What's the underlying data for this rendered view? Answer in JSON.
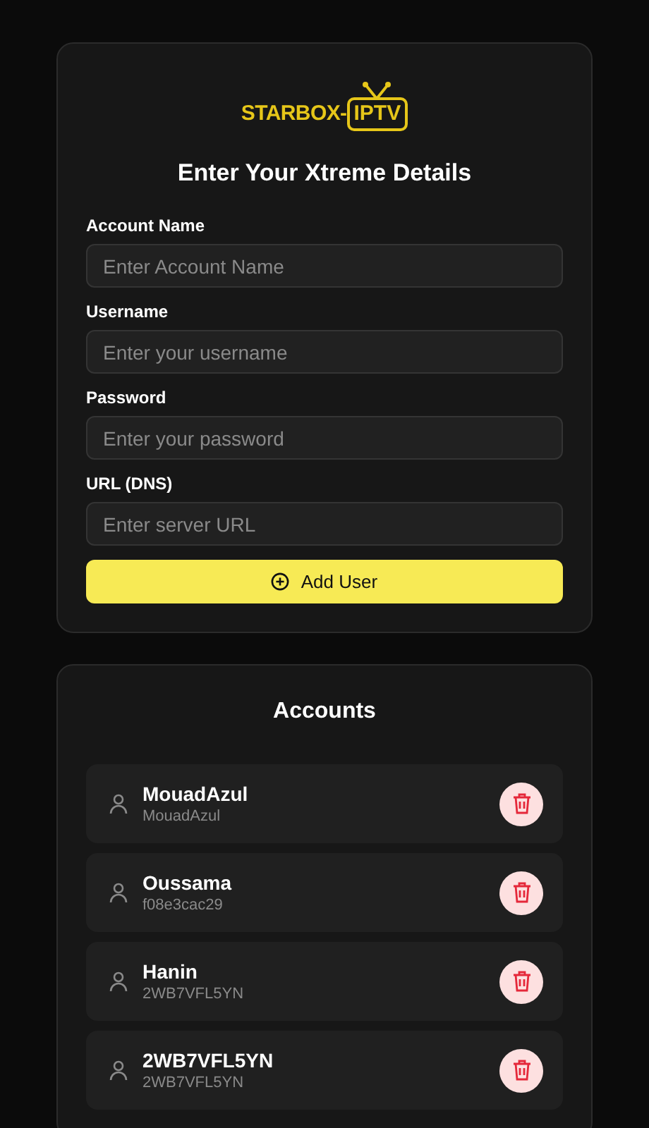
{
  "logo": {
    "brand": "STARBOX-",
    "badge": "IPTV"
  },
  "form": {
    "title": "Enter Your Xtreme Details",
    "fields": [
      {
        "label": "Account Name",
        "placeholder": "Enter Account Name"
      },
      {
        "label": "Username",
        "placeholder": "Enter your username"
      },
      {
        "label": "Password",
        "placeholder": "Enter your password"
      },
      {
        "label": "URL (DNS)",
        "placeholder": "Enter server URL"
      }
    ],
    "button": "Add User"
  },
  "accounts": {
    "title": "Accounts",
    "items": [
      {
        "name": "MouadAzul",
        "username": "MouadAzul"
      },
      {
        "name": "Oussama",
        "username": "f08e3cac29"
      },
      {
        "name": "Hanin",
        "username": "2WB7VFL5YN"
      },
      {
        "name": "2WB7VFL5YN",
        "username": "2WB7VFL5YN"
      }
    ]
  }
}
